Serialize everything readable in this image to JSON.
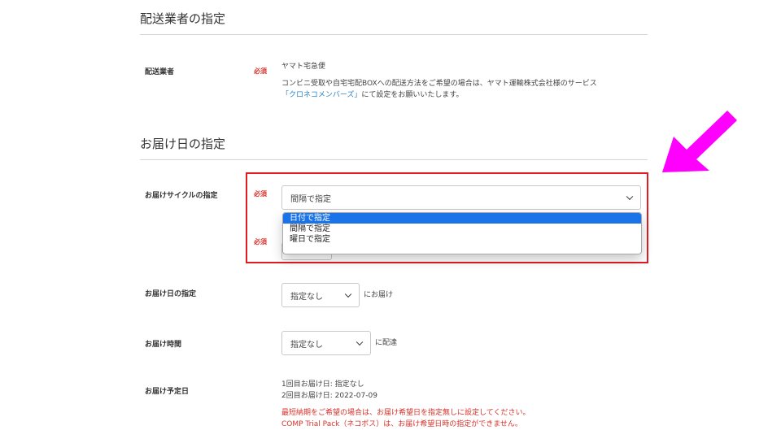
{
  "carrier_section": {
    "title": "配送業者の指定",
    "label": "配送業者",
    "required": "必須",
    "value": "ヤマト宅急便",
    "note_line1": "コンビニ受取や自宅宅配BOXへの配送方法をご希望の場合は、ヤマト運輸株式会社様のサービス",
    "note_link": "「クロネコメンバーズ」",
    "note_line2_rest": "にて設定をお願いいたします。"
  },
  "delivery_section": {
    "title": "お届け日の指定",
    "cycle": {
      "label": "お届けサイクルの指定",
      "required": "必須",
      "selected": "間隔で指定",
      "options": [
        "日付で指定",
        "間隔で指定",
        "曜日で指定"
      ],
      "second_required": "必須"
    },
    "date": {
      "label": "お届け日の指定",
      "selected": "指定なし",
      "suffix": "にお届け"
    },
    "time": {
      "label": "お届け時間",
      "selected": "指定なし",
      "suffix": "に配達"
    },
    "scheduled": {
      "label": "お届け予定日",
      "line1": "1回目お届け日: 指定なし",
      "line2": "2回目お届け日: 2022-07-09",
      "warning1": "最短納期をご希望の場合は、お届け希望日を指定無しに設定してください。",
      "warning2": "COMP Trial Pack（ネコポス）は、お届け希望日時の指定ができません。"
    }
  },
  "colors": {
    "required": "#d9322b",
    "link": "#2f86c9",
    "highlight": "#e21b23",
    "arrow": "#ff00ff",
    "option_selected": "#1a73e8"
  }
}
